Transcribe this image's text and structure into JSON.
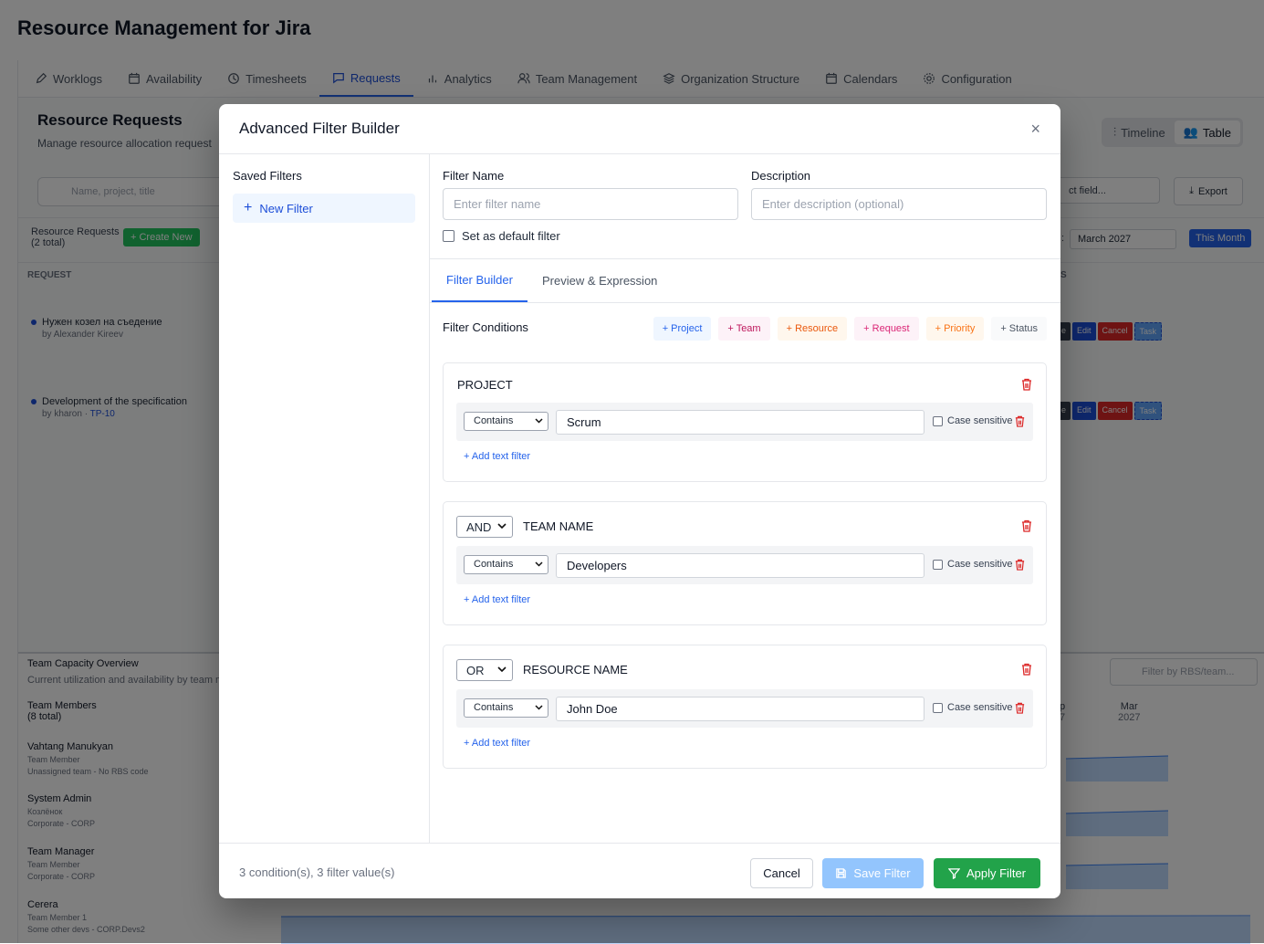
{
  "app_title": "Resource Management for Jira",
  "nav": {
    "tabs": [
      {
        "label": "Worklogs",
        "icon": "pencil-icon"
      },
      {
        "label": "Availability",
        "icon": "calendar-icon"
      },
      {
        "label": "Timesheets",
        "icon": "clock-icon"
      },
      {
        "label": "Requests",
        "icon": "message-icon",
        "active": true
      },
      {
        "label": "Analytics",
        "icon": "bar-chart-icon"
      },
      {
        "label": "Team Management",
        "icon": "users-icon"
      },
      {
        "label": "Organization Structure",
        "icon": "layers-icon"
      },
      {
        "label": "Calendars",
        "icon": "calendar-icon"
      },
      {
        "label": "Configuration",
        "icon": "gear-icon"
      }
    ]
  },
  "background": {
    "title": "Resource Requests",
    "subtitle": "Manage resource allocation request",
    "view_timeline": "Timeline",
    "view_table": "Table",
    "search_placeholder": "Name, project, title",
    "select_field": "ct field...",
    "export": "Export",
    "requests_label": "Resource Requests",
    "requests_count": "(2 total)",
    "create_new": "+ Create New",
    "month_colon": ":",
    "month": "March 2027",
    "this_month": "This Month",
    "col_request": "REQUEST",
    "col_s": "S",
    "rows": [
      {
        "title": "Нужен козел на съедение",
        "by": "by Alexander Kireev",
        "link": ""
      },
      {
        "title": "Development of the specification",
        "by": "by kharon · ",
        "link": "TP-10"
      }
    ],
    "action_e": "e",
    "action_edit": "Edit",
    "action_cancel": "Cancel",
    "action_task": "Task",
    "capacity_title": "Team Capacity Overview",
    "capacity_sub": "Current utilization and availability by team m",
    "filter_placeholder": "Filter by RBS/team...",
    "members_label": "Team Members",
    "members_count": "(8 total)",
    "chart_month_p": "p",
    "chart_year_7": "7",
    "chart_month": "Mar",
    "chart_year": "2027",
    "members": [
      {
        "name": "Vahtang Manukyan",
        "role": "Team Member",
        "team": "Unassigned team - No RBS code"
      },
      {
        "name": "System Admin",
        "role": "Козлёнок",
        "team": "Corporate - CORP"
      },
      {
        "name": "Team Manager",
        "role": "Team Member",
        "team": "Corporate - CORP"
      },
      {
        "name": "Cerera",
        "role": "Team Member 1",
        "team": "Some other devs - CORP.Devs2"
      }
    ]
  },
  "modal": {
    "title": "Advanced Filter Builder",
    "close": "×",
    "saved_filters": "Saved Filters",
    "new_filter": "New Filter",
    "filter_name_label": "Filter Name",
    "filter_name_placeholder": "Enter filter name",
    "description_label": "Description",
    "description_placeholder": "Enter description (optional)",
    "default_label": "Set as default filter",
    "tab_builder": "Filter Builder",
    "tab_preview": "Preview & Expression",
    "conditions_label": "Filter Conditions",
    "chips": [
      {
        "label": "+ Project",
        "color": "#2563eb",
        "bg": "#eff6ff"
      },
      {
        "label": "+ Team",
        "color": "#be185d",
        "bg": "#fdf2f8"
      },
      {
        "label": "+ Resource",
        "color": "#ea580c",
        "bg": "#fff7ed"
      },
      {
        "label": "+ Request",
        "color": "#db2777",
        "bg": "#fdf2f8"
      },
      {
        "label": "+ Priority",
        "color": "#f97316",
        "bg": "#fff7ed"
      },
      {
        "label": "+ Status",
        "color": "#4b5563",
        "bg": "#f9fafb"
      }
    ],
    "groups": [
      {
        "operator": "",
        "title": "PROJECT",
        "condition": "Contains",
        "value": "Scrum",
        "case": "Case sensitive",
        "add": "+ Add text filter"
      },
      {
        "operator": "AND",
        "title": "TEAM NAME",
        "condition": "Contains",
        "value": "Developers",
        "case": "Case sensitive",
        "add": "+ Add text filter"
      },
      {
        "operator": "OR",
        "title": "RESOURCE NAME",
        "condition": "Contains",
        "value": "John Doe",
        "case": "Case sensitive",
        "add": "+ Add text filter"
      }
    ],
    "footer_info": "3 condition(s), 3 filter value(s)",
    "cancel": "Cancel",
    "save": "Save Filter",
    "apply": "Apply Filter"
  }
}
